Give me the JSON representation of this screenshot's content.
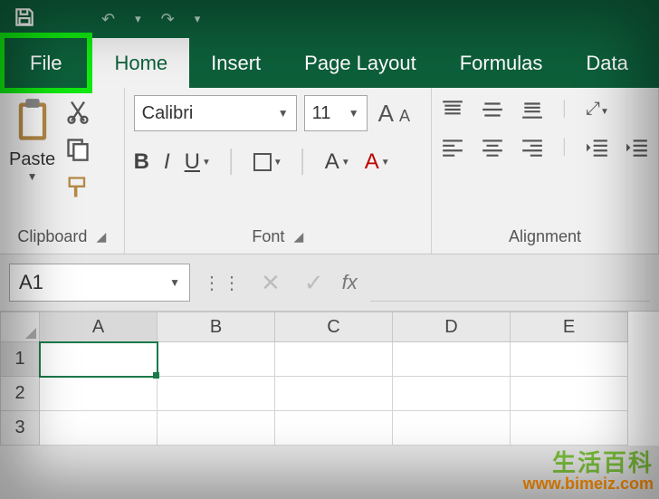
{
  "qat": {
    "save": "save-icon"
  },
  "tabs": {
    "file": "File",
    "home": "Home",
    "insert": "Insert",
    "page_layout": "Page Layout",
    "formulas": "Formulas",
    "data": "Data"
  },
  "ribbon": {
    "clipboard": {
      "paste": "Paste",
      "label": "Clipboard"
    },
    "font": {
      "name": "Calibri",
      "size": "11",
      "bold": "B",
      "italic": "I",
      "underline": "U",
      "grow": "A",
      "shrink": "A",
      "fill_letter": "A",
      "color_letter": "A",
      "label": "Font"
    },
    "alignment": {
      "label": "Alignment"
    }
  },
  "formula_bar": {
    "name_box": "A1",
    "cancel": "✕",
    "enter": "✓",
    "fx": "fx"
  },
  "grid": {
    "columns": [
      "A",
      "B",
      "C",
      "D",
      "E"
    ],
    "rows": [
      "1",
      "2",
      "3"
    ],
    "active_cell": "A1"
  },
  "watermark": {
    "cn": "生活百科",
    "url": "www.bimeiz.com"
  }
}
